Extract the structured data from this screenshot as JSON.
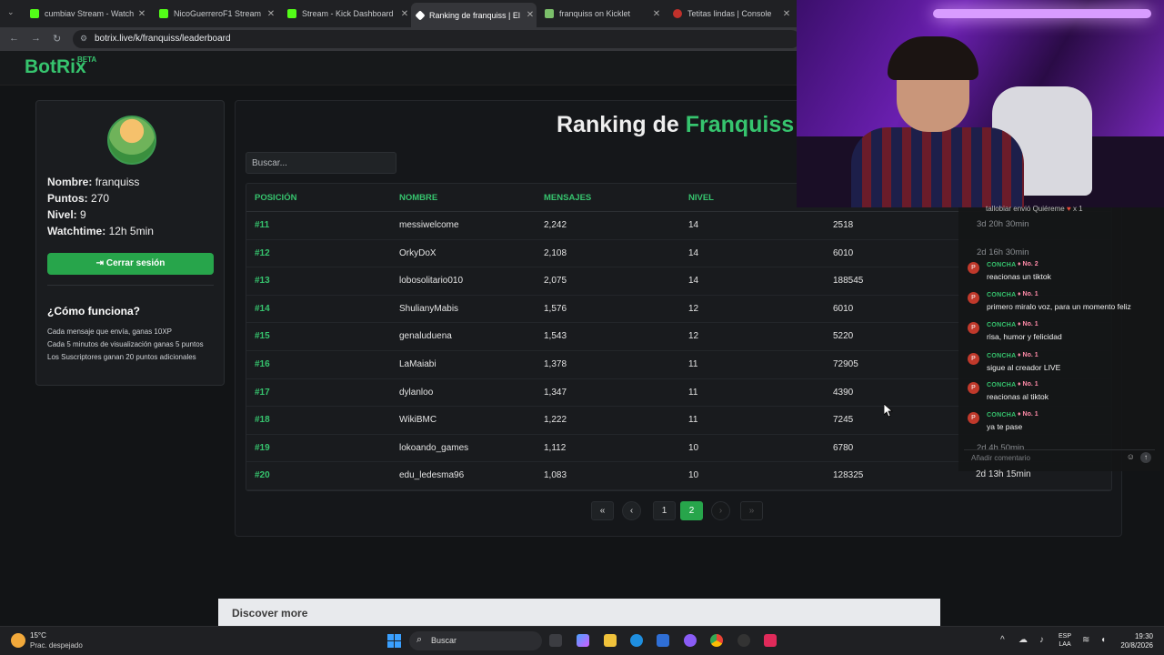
{
  "browser": {
    "tabs": [
      {
        "title": "cumbiav Stream - Watch L",
        "active": false
      },
      {
        "title": "NicoGuerreroF1 Stream",
        "active": false
      },
      {
        "title": "Stream - Kick Dashboard",
        "active": false
      },
      {
        "title": "Ranking de franquiss | El",
        "active": true
      },
      {
        "title": "franquiss on Kicklet",
        "active": false
      },
      {
        "title": "Tetitas lindas | Console",
        "active": false
      }
    ],
    "url": "botrix.live/k/franquiss/leaderboard"
  },
  "site": {
    "logo": "BotRix",
    "badge": "BETA"
  },
  "profile": {
    "name_label": "Nombre:",
    "name_value": "franquiss",
    "points_label": "Puntos:",
    "points_value": "270",
    "level_label": "Nivel:",
    "level_value": "9",
    "watch_label": "Watchtime:",
    "watch_value": "12h 5min",
    "logout_label": "Cerrar sesión",
    "how_title": "¿Cómo funciona?",
    "how_lines": [
      "Cada mensaje que envía, ganas 10XP",
      "Cada 5 minutos de visualización ganas 5 puntos",
      "Los Suscriptores ganan 20 puntos adicionales"
    ]
  },
  "leaderboard": {
    "title_prefix": "Ranking de ",
    "title_user": "Franquiss",
    "search_placeholder": "Buscar...",
    "columns": [
      "POSICIÓN",
      "NOMBRE",
      "MENSAJES",
      "NIVEL"
    ],
    "rows": [
      {
        "pos": "#11",
        "name": "messiwelcome",
        "messages": "2,242",
        "level": "14",
        "points": "2518"
      },
      {
        "pos": "#12",
        "name": "OrkyDoX",
        "messages": "2,108",
        "level": "14",
        "points": "6010"
      },
      {
        "pos": "#13",
        "name": "lobosolitario010",
        "messages": "2,075",
        "level": "14",
        "points": "188545"
      },
      {
        "pos": "#14",
        "name": "ShulianyMabis",
        "messages": "1,576",
        "level": "12",
        "points": "6010"
      },
      {
        "pos": "#15",
        "name": "genaluduena",
        "messages": "1,543",
        "level": "12",
        "points": "5220"
      },
      {
        "pos": "#16",
        "name": "LaMaiabi",
        "messages": "1,378",
        "level": "11",
        "points": "72905"
      },
      {
        "pos": "#17",
        "name": "dylanloo",
        "messages": "1,347",
        "level": "11",
        "points": "4390"
      },
      {
        "pos": "#18",
        "name": "WikiBMC",
        "messages": "1,222",
        "level": "11",
        "points": "7245"
      },
      {
        "pos": "#19",
        "name": "lokoando_games",
        "messages": "1,112",
        "level": "10",
        "points": "6780"
      },
      {
        "pos": "#20",
        "name": "edu_ledesma96",
        "messages": "1,083",
        "level": "10",
        "points": "128325"
      }
    ],
    "pagination": {
      "first": "«",
      "prev": "‹",
      "pages": [
        "1",
        "2"
      ],
      "current": "2",
      "next": "›",
      "last": "»"
    }
  },
  "discover": "Discover more",
  "chat": {
    "top_partial": "tallobiar envió Quiéreme",
    "top_count": "x 1",
    "ghost_lines": [
      "3d 20h 30min",
      "2d 16h 30min",
      "2d 4h 50min"
    ],
    "messages": [
      {
        "user": "CONCHA",
        "badge": "No. 2",
        "text": "reacionas un tiktok"
      },
      {
        "user": "CONCHA",
        "badge": "No. 1",
        "text": "primero miralo voz, para un momento feliz"
      },
      {
        "user": "CONCHA",
        "badge": "No. 1",
        "text": "risa, humor y felicidad"
      },
      {
        "user": "CONCHA",
        "badge": "No. 1",
        "text": "sigue al creador LIVE"
      },
      {
        "user": "CONCHA",
        "badge": "No. 1",
        "text": "reacionas al tiktok"
      },
      {
        "user": "CONCHA",
        "badge": "No. 1",
        "text": "ya te pase"
      }
    ],
    "input_placeholder": "Añadir comentario",
    "behind_time": "2d 13h 15min"
  },
  "taskbar": {
    "temp": "15°C",
    "weather": "Prac. despejado",
    "search": "Buscar",
    "lang_top": "ESP",
    "lang_bottom": "LAA",
    "time": "19:30",
    "date": "20/8/2026"
  },
  "colors": {
    "accent": "#36c46e",
    "button": "#27a54b",
    "background": "#121416"
  }
}
